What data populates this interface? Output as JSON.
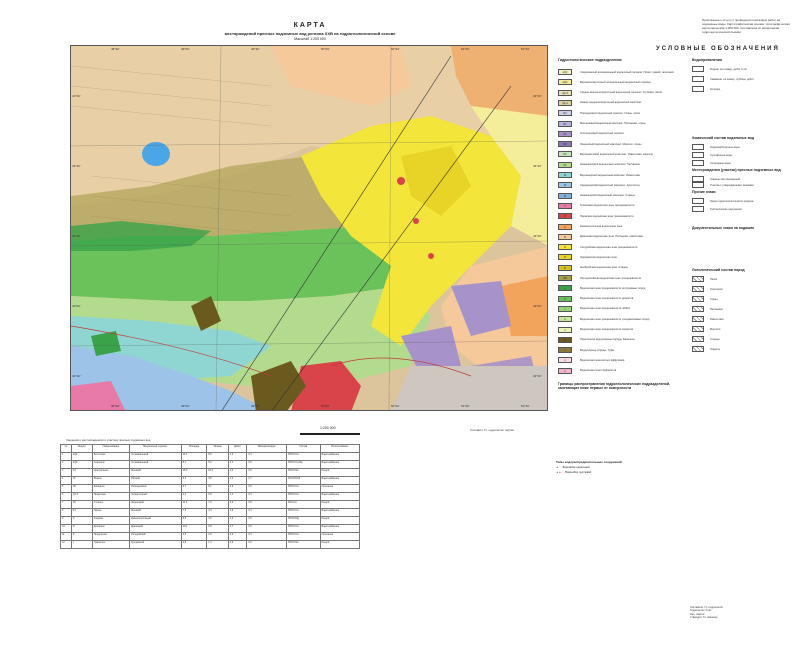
{
  "title": {
    "word": "КАРТА",
    "subtitle": "месторождений пресных подземных вод региона ХХВ на гидрогеологической основе",
    "scale_text": "Масштаб 1:200 000"
  },
  "top_right_note": "Приложение к отчету о проведении поисковых работ на подземные воды. Картографическая основа: топографическая карта масштаба 1:200 000. Составлена по материалам гидрогеологической съёмки",
  "map": {
    "top_coords": [
      "48°30'",
      "49°00'",
      "49°30'",
      "50°00'",
      "50°30'",
      "51°00'",
      "51°30'"
    ],
    "bottom_coords": [
      "48°30'",
      "49°00'",
      "49°30'",
      "50°00'",
      "50°30'",
      "51°00'",
      "51°30'"
    ],
    "left_coords": [
      "44°00'",
      "43°40'",
      "43°20'",
      "43°00'",
      "42°40'"
    ],
    "right_coords": [
      "44°00'",
      "43°40'",
      "43°20'",
      "43°00'",
      "42°40'"
    ],
    "colors": {
      "yellow": "#f3e53a",
      "pale_yellow": "#f4ed9a",
      "orange": "#f2a45c",
      "peach": "#f6c99a",
      "tan": "#dcc49c",
      "green_dark": "#3aa34a",
      "green": "#6cc25a",
      "green_light": "#b2db8e",
      "cyan": "#8fd6d2",
      "blue": "#9ec3e8",
      "lake": "#4aa6e6",
      "purple": "#a792c9",
      "pink": "#e87aa8",
      "red": "#d9434a",
      "brown": "#6b5a1e",
      "olive": "#a8a04a"
    }
  },
  "legend": {
    "title": "УСЛОВНЫЕ ОБОЗНАЧЕНИЯ",
    "section_hydro": "Гидрогеологические подразделения",
    "section_water": "Водопроявления",
    "section_chem": "Химический состав подземных вод",
    "section_fields": "Месторождения (участки) пресных подземных вод",
    "section_other": "Прочие знаки",
    "section_doc": "Документальные знаки на подошве",
    "section_litho": "Литологический состав пород",
    "section_boundaries": "Границы распространения гидрогеологических подразделений, залегающих ниже первых от поверхности",
    "hydro_units": [
      {
        "code": "aQ4",
        "color": "#f6f1c4",
        "text": "Современный аллювиальный водоносный горизонт. Пески, гравий, галечники"
      },
      {
        "code": "aQ3",
        "color": "#f4ed9a",
        "text": "Верхнечетвертичный аллювиальный водоносный горизонт"
      },
      {
        "code": "Q2-3",
        "color": "#e9e0b8",
        "text": "Средне-верхнечетвертичный водоносный горизонт. Суглинки, пески"
      },
      {
        "code": "Q1-2",
        "color": "#ddd3a0",
        "text": "Нижне-среднечетвертичный водоносный комплекс"
      },
      {
        "code": "N2",
        "color": "#cfd0e8",
        "text": "Плиоценовый водоносный горизонт. Глины, пески"
      },
      {
        "code": "N1",
        "color": "#b7b5dd",
        "text": "Миоценовый водоносный комплекс. Песчаники, глины"
      },
      {
        "code": "P3",
        "color": "#a792c9",
        "text": "Олигоценовый водоносный горизонт"
      },
      {
        "code": "P2",
        "color": "#8f78b5",
        "text": "Эоценовый водоносный комплекс. Мергели, глины"
      },
      {
        "code": "K2",
        "color": "#c7e4bf",
        "text": "Верхнемеловой водоносный комплекс. Известняки, мергели"
      },
      {
        "code": "K1",
        "color": "#b2db8e",
        "text": "Нижнемеловой водоносный комплекс. Песчаники"
      },
      {
        "code": "J3",
        "color": "#8fd6d2",
        "text": "Верхнеюрский водоносный комплекс. Известняки"
      },
      {
        "code": "J2",
        "color": "#9ec3e8",
        "text": "Среднеюрский водоносный комплекс. Аргиллиты"
      },
      {
        "code": "J1",
        "color": "#7fb0e0",
        "text": "Нижнеюрский водоносный комплекс. Сланцы"
      },
      {
        "code": "T",
        "color": "#e87aa8",
        "text": "Триасовая водоносная зона трещиноватости"
      },
      {
        "code": "P",
        "color": "#d9434a",
        "text": "Пермская водоносная зона трещиноватости"
      },
      {
        "code": "C",
        "color": "#f2a45c",
        "text": "Каменноугольная водоносная зона"
      },
      {
        "code": "D",
        "color": "#f6c99a",
        "text": "Девонская водоносная зона. Песчаники, известняки"
      },
      {
        "code": "S",
        "color": "#f3e53a",
        "text": "Силурийская водоносная зона трещиноватости"
      },
      {
        "code": "O",
        "color": "#e8d426",
        "text": "Ордовикская водоносная зона"
      },
      {
        "code": "Є",
        "color": "#d6c21c",
        "text": "Кембрийская водоносная зона. Сланцы"
      },
      {
        "code": "PR",
        "color": "#a8a04a",
        "text": "Протерозойская водоносная зона трещиноватости"
      },
      {
        "code": "γ",
        "color": "#3aa34a",
        "text": "Водоносная зона трещиноватости интрузивных пород"
      },
      {
        "code": "δ",
        "color": "#6cc25a",
        "text": "Водоносная зона трещиноватости диоритов"
      },
      {
        "code": "ν",
        "color": "#98d47a",
        "text": "Водоносная зона трещиноватости габбро"
      },
      {
        "code": "σ",
        "color": "#c8e89e",
        "text": "Водоносная зона трещиноватости ультраосновных пород"
      },
      {
        "code": "ξ",
        "color": "#e9f4b8",
        "text": "Водоносная зона трещиноватости сиенитов"
      },
      {
        "code": "β",
        "color": "#6b5a1e",
        "text": "Практически водоупорные породы. Базальты"
      },
      {
        "code": "τ",
        "color": "#8c7a3c",
        "text": "Водоупорные породы. Туфы"
      },
      {
        "code": "λ",
        "color": "#f9d9e4",
        "text": "Водоносная зона кислых эффузивов"
      },
      {
        "code": "π",
        "color": "#f5b3c9",
        "text": "Водоносная зона порфиритов"
      }
    ],
    "right_items": [
      "Родник, его номер, дебит в л/с",
      "Скважина, её номер, глубина, дебит",
      "Колодец",
      "Гидрокарбонатные воды",
      "Сульфатные воды",
      "Хлоридные воды",
      "Границы месторождений",
      "Участки с утверждёнными запасами",
      "Линия гидрогеологического разреза",
      "Тектонические нарушения",
      "Пески",
      "Галечники",
      "Глины",
      "Песчаники",
      "Известняки",
      "Мергели",
      "Сланцы",
      "Граниты"
    ]
  },
  "scale_label": "1:200 000",
  "author_note": "Составил: Гл. гидрогеолог партии",
  "table": {
    "caption": "Сведения о месторождениях и участках пресных подземных вод",
    "headers": [
      "№",
      "Индекс",
      "Наименование",
      "Водоносный горизонт",
      "Площадь",
      "Запасы",
      "Дебит",
      "Минерализация",
      "Состав",
      "Использование"
    ],
    "rows": [
      [
        "1",
        "aQ4",
        "Восточное",
        "Аллювиальный",
        "12,4",
        "8,6",
        "3,2",
        "0,4",
        "HCO3-Ca",
        "Водоснабжение"
      ],
      [
        "2",
        "aQ3",
        "Северное",
        "Аллювиальный",
        "8,1",
        "5,2",
        "2,1",
        "0,5",
        "HCO3-Ca-Mg",
        "Водоснабжение"
      ],
      [
        "3",
        "K2",
        "Центральное",
        "Меловой",
        "15,0",
        "10,4",
        "4,0",
        "0,6",
        "HCO3-Na",
        "Резерв"
      ],
      [
        "4",
        "J3",
        "Южное",
        "Юрский",
        "6,3",
        "3,8",
        "1,4",
        "0,7",
        "SO4-HCO3",
        "Водоснабжение"
      ],
      [
        "5",
        "N2",
        "Западное",
        "Плиоценовый",
        "9,7",
        "6,1",
        "2,6",
        "0,5",
        "HCO3-Ca",
        "Орошение"
      ],
      [
        "6",
        "Q2-3",
        "Приречное",
        "Четвертичный",
        "4,2",
        "2,5",
        "1,1",
        "0,3",
        "HCO3-Ca",
        "Водоснабжение"
      ],
      [
        "7",
        "P2",
        "Степное",
        "Эоценовый",
        "11,3",
        "7,0",
        "2,9",
        "0,8",
        "SO4-Ca",
        "Резерв"
      ],
      [
        "8",
        "K1",
        "Горное",
        "Меловой",
        "7,5",
        "4,4",
        "1,8",
        "0,4",
        "HCO3-Ca",
        "Водоснабжение"
      ],
      [
        "9",
        "C",
        "Озёрное",
        "Каменноугольный",
        "5,9",
        "3,2",
        "1,2",
        "0,6",
        "HCO3-Mg",
        "Резерв"
      ],
      [
        "10",
        "D",
        "Долинное",
        "Девонский",
        "10,2",
        "6,8",
        "2,7",
        "0,5",
        "HCO3-Ca",
        "Водоснабжение"
      ],
      [
        "11",
        "S",
        "Предгорное",
        "Силурийский",
        "3,6",
        "2,0",
        "0,9",
        "0,3",
        "HCO3-Ca",
        "Орошение"
      ],
      [
        "12",
        "γ",
        "Гранитное",
        "Трещинный",
        "2,8",
        "1,4",
        "0,6",
        "0,2",
        "HCO3-Na",
        "Резерв"
      ]
    ]
  },
  "wells_block": {
    "heading": "Типы водораспределительных сооружений",
    "items": [
      "Водозабор одиночный",
      "Водозабор групповой"
    ]
  },
  "signs": [
    "Составили: Гл. гидрогеолог",
    "Гидрогеолог 1 кат.",
    "Нач. партии",
    "Утвердил: Гл. инженер"
  ]
}
